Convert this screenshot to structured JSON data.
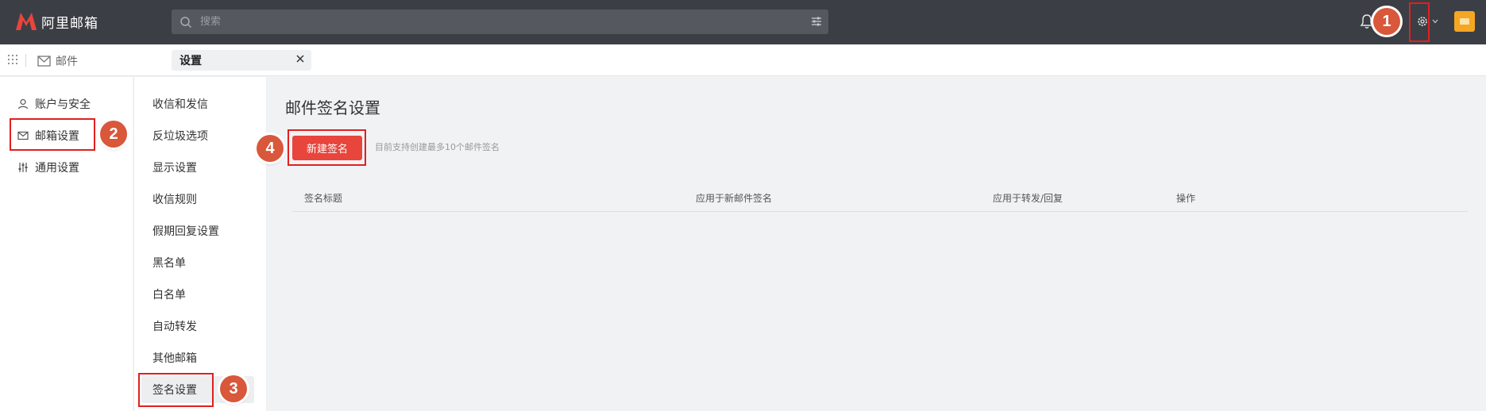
{
  "app": {
    "brand_name": "阿里邮箱",
    "brand_color": "#e8453c"
  },
  "search": {
    "placeholder": "搜索"
  },
  "tabs": {
    "mail_label": "邮件",
    "settings_label": "设置"
  },
  "left_nav": {
    "items": [
      {
        "label": "账户与安全",
        "icon": "user-icon"
      },
      {
        "label": "邮箱设置",
        "icon": "mailbox-settings-icon"
      },
      {
        "label": "通用设置",
        "icon": "sliders-icon"
      }
    ]
  },
  "mid_nav": {
    "items": [
      "收信和发信",
      "反垃圾选项",
      "显示设置",
      "收信规则",
      "假期回复设置",
      "黑名单",
      "白名单",
      "自动转发",
      "其他邮箱",
      "签名设置"
    ]
  },
  "main": {
    "title": "邮件签名设置",
    "new_button": "新建签名",
    "hint": "目前支持创建最多10个邮件签名",
    "columns": [
      "签名标题",
      "应用于新邮件签名",
      "应用于转发/回复",
      "操作"
    ]
  },
  "annotations": [
    "1",
    "2",
    "3",
    "4"
  ],
  "colors": {
    "topbar": "#3b3f45",
    "highlight_box": "#e02020",
    "badge": "#d9573a",
    "app_tile": "#f5a623"
  }
}
